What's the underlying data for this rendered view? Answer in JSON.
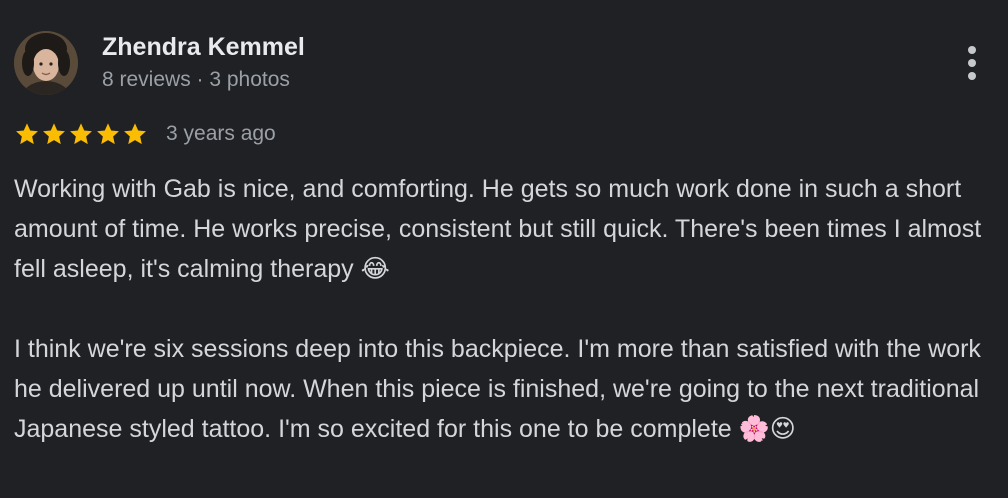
{
  "review": {
    "author": {
      "name": "Zhendra Kemmel",
      "meta": "8 reviews · 3 photos",
      "avatar_icon": "profile-photo"
    },
    "more_icon": "more-vert-icon",
    "rating": {
      "stars": 5,
      "max": 5,
      "star_color": "#fbbc04"
    },
    "date": "3 years ago",
    "text": "Working with Gab is nice, and comforting. He gets so much work done in such a short amount of time. He works precise, consistent but still quick. There's been times I almost fell asleep, it's calming therapy 😂\n\nI think we're six sessions deep into this backpiece. I'm more than satisfied with the work he delivered up until now. When this piece is finished, we're going to the next traditional Japanese styled tattoo. I'm so excited for this one to be complete 🌸😍"
  },
  "colors": {
    "background": "#202124",
    "name": "#e8eaed",
    "meta": "#9aa0a6",
    "body_text": "#d4d6d9"
  }
}
